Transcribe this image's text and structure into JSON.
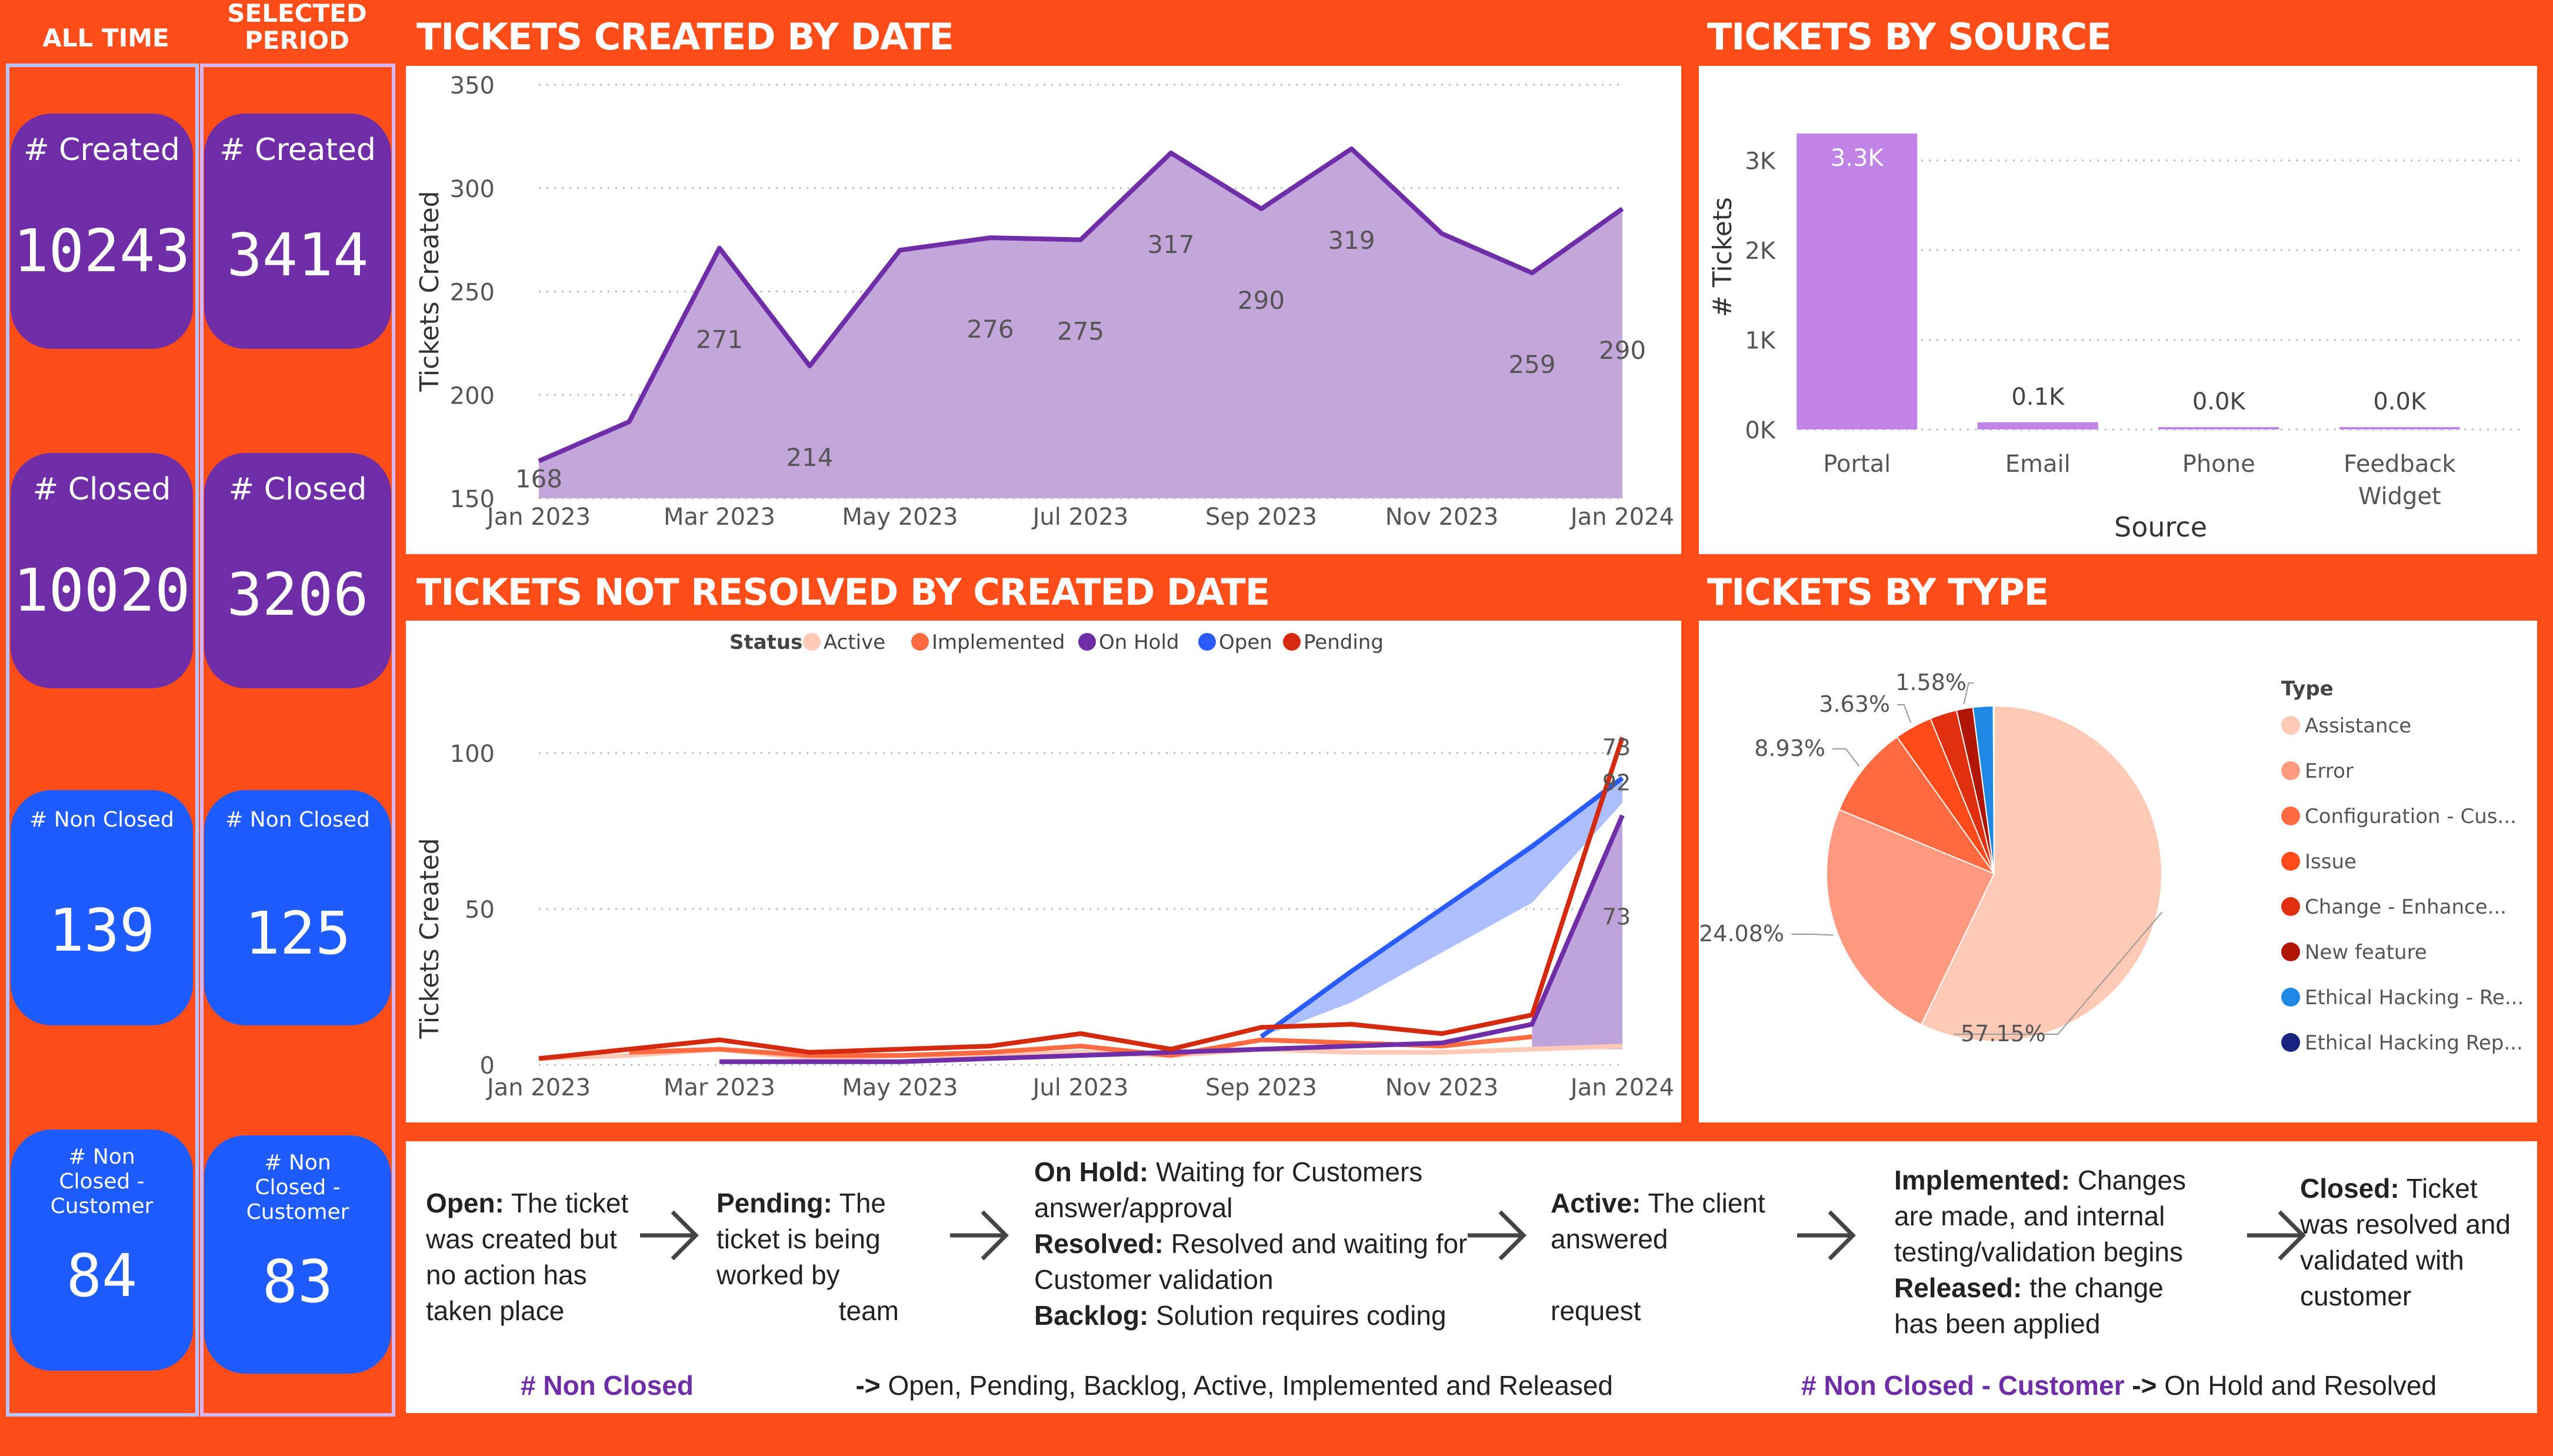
{
  "columns": {
    "all_time": "ALL TIME",
    "selected_period": "SELECTED PERIOD"
  },
  "kpis": {
    "all_time": [
      {
        "label": "# Created",
        "value": "10243"
      },
      {
        "label": "# Closed",
        "value": "10020"
      },
      {
        "label": "# Non Closed",
        "value": "139"
      },
      {
        "label": "# Non Closed - Customer",
        "value": "84"
      }
    ],
    "selected_period": [
      {
        "label": "# Created",
        "value": "3414"
      },
      {
        "label": "# Closed",
        "value": "3206"
      },
      {
        "label": "# Non Closed",
        "value": "125"
      },
      {
        "label": "# Non Closed - Customer",
        "value": "83"
      }
    ]
  },
  "titles": {
    "created_by_date": "TICKETS CREATED BY DATE",
    "by_source": "TICKETS BY SOURCE",
    "not_resolved": "TICKETS NOT RESOLVED BY CREATED DATE",
    "by_type": "TICKETS BY TYPE"
  },
  "colors": {
    "orange_bg": "#ff4d1a",
    "purple": "#6f2da8",
    "blue": "#1f5cff",
    "area_fill": "#c3a6da",
    "bar": "#c084e6"
  },
  "chart_data": [
    {
      "id": "created_by_date",
      "type": "area",
      "x": [
        "Jan 2023",
        "Feb 2023",
        "Mar 2023",
        "Apr 2023",
        "May 2023",
        "Jun 2023",
        "Jul 2023",
        "Aug 2023",
        "Sep 2023",
        "Oct 2023",
        "Nov 2023",
        "Dec 2023",
        "Jan 2024"
      ],
      "values": [
        168,
        187,
        271,
        214,
        270,
        276,
        275,
        317,
        290,
        319,
        278,
        259,
        290
      ],
      "data_labels": [
        168,
        null,
        271,
        214,
        null,
        276,
        275,
        317,
        290,
        319,
        null,
        259,
        290
      ],
      "xticks": [
        "Jan 2023",
        "Mar 2023",
        "May 2023",
        "Jul 2023",
        "Sep 2023",
        "Nov 2023",
        "Jan 2024"
      ],
      "ylabel": "Tickets Created",
      "yticks": [
        150,
        200,
        250,
        300,
        350
      ],
      "ylim": [
        150,
        350
      ],
      "grid": true
    },
    {
      "id": "by_source",
      "type": "bar",
      "categories": [
        "Portal",
        "Email",
        "Phone",
        "Feedback Widget"
      ],
      "values": [
        3300,
        80,
        10,
        5
      ],
      "data_labels": [
        "3.3K",
        "0.1K",
        "0.0K",
        "0.0K"
      ],
      "xlabel": "Source",
      "ylabel": "# Tickets",
      "yticks": [
        "0K",
        "1K",
        "2K",
        "3K"
      ],
      "ylim": [
        0,
        3300
      ],
      "grid": true
    },
    {
      "id": "not_resolved",
      "type": "line",
      "legend_title": "Status",
      "legend_position": "top",
      "x": [
        "Jan 2023",
        "Feb 2023",
        "Mar 2023",
        "Apr 2023",
        "May 2023",
        "Jun 2023",
        "Jul 2023",
        "Aug 2023",
        "Sep 2023",
        "Oct 2023",
        "Nov 2023",
        "Dec 2023",
        "Jan 2024"
      ],
      "xticks": [
        "Jan 2023",
        "Mar 2023",
        "May 2023",
        "Jul 2023",
        "Sep 2023",
        "Nov 2023",
        "Jan 2024"
      ],
      "ylabel": "Tickets Created",
      "yticks": [
        0,
        50,
        100
      ],
      "ylim": [
        0,
        110
      ],
      "series": [
        {
          "name": "Active",
          "color": "#ffc9b5",
          "values": [
            2,
            3,
            5,
            2,
            3,
            3,
            4,
            3,
            5,
            4,
            4,
            5,
            6
          ]
        },
        {
          "name": "Implemented",
          "color": "#ff6a40",
          "values": [
            null,
            4,
            5,
            3,
            3,
            4,
            6,
            3,
            8,
            7,
            6,
            9,
            null
          ]
        },
        {
          "name": "On Hold",
          "color": "#6f2da8",
          "values": [
            null,
            null,
            1,
            1,
            1,
            2,
            3,
            4,
            5,
            6,
            7,
            13,
            80
          ]
        },
        {
          "name": "Open",
          "color": "#2a5bff",
          "values": [
            null,
            null,
            null,
            null,
            null,
            null,
            null,
            null,
            9,
            30,
            50,
            70,
            92
          ]
        },
        {
          "name": "Pending",
          "color": "#d42a10",
          "values": [
            2,
            5,
            8,
            4,
            5,
            6,
            10,
            5,
            12,
            13,
            10,
            16,
            105
          ]
        }
      ],
      "data_labels": [
        "73",
        "92",
        "73"
      ],
      "grid": true
    },
    {
      "id": "by_type",
      "type": "pie",
      "legend_title": "Type",
      "legend_position": "right",
      "categories": [
        "Assistance",
        "Error",
        "Configuration - Cus...",
        "Issue",
        "Change - Enhance...",
        "New feature",
        "Ethical Hacking - Re...",
        "Ethical Hacking Rep..."
      ],
      "values": [
        57.15,
        24.08,
        8.93,
        3.63,
        2.6,
        1.58,
        1.95,
        0.08
      ],
      "colors": [
        "#ffc9b5",
        "#ff9a80",
        "#ff6a40",
        "#ff4a1a",
        "#e03010",
        "#b01505",
        "#1e88e5",
        "#1a237e"
      ],
      "data_labels": [
        "57.15%",
        "24.08%",
        "8.93%",
        "3.63%",
        null,
        "1.58%",
        null,
        null
      ]
    }
  ],
  "statuses": {
    "open": {
      "name": "Open:",
      "text": "The ticket was created but no action has taken place"
    },
    "pending": {
      "name": "Pending:",
      "text1": "The ticket is being worked by",
      "text2": "team"
    },
    "onhold": {
      "name": "On Hold:",
      "text": "Waiting for Customers answer/approval"
    },
    "resolved": {
      "name": "Resolved:",
      "text": "Resolved and waiting for Customer validation"
    },
    "backlog": {
      "name": "Backlog:",
      "text": "Solution requires coding"
    },
    "active": {
      "name": "Active:",
      "text1": "The client answered",
      "text2": "request"
    },
    "implemented": {
      "name": "Implemented:",
      "text": "Changes are made, and internal testing/validation begins"
    },
    "released": {
      "name": "Released:",
      "text": "the change has been applied"
    },
    "closed": {
      "name": "Closed:",
      "text": "Ticket was resolved and validated with customer"
    }
  },
  "footer": {
    "nonclosed_label": "# Non Closed",
    "nonclosed_arrow": "->",
    "nonclosed_text": "Open, Pending, Backlog, Active, Implemented and Released",
    "customer_label": "# Non Closed - Customer",
    "customer_arrow": "->",
    "customer_text": "On Hold and Resolved"
  }
}
